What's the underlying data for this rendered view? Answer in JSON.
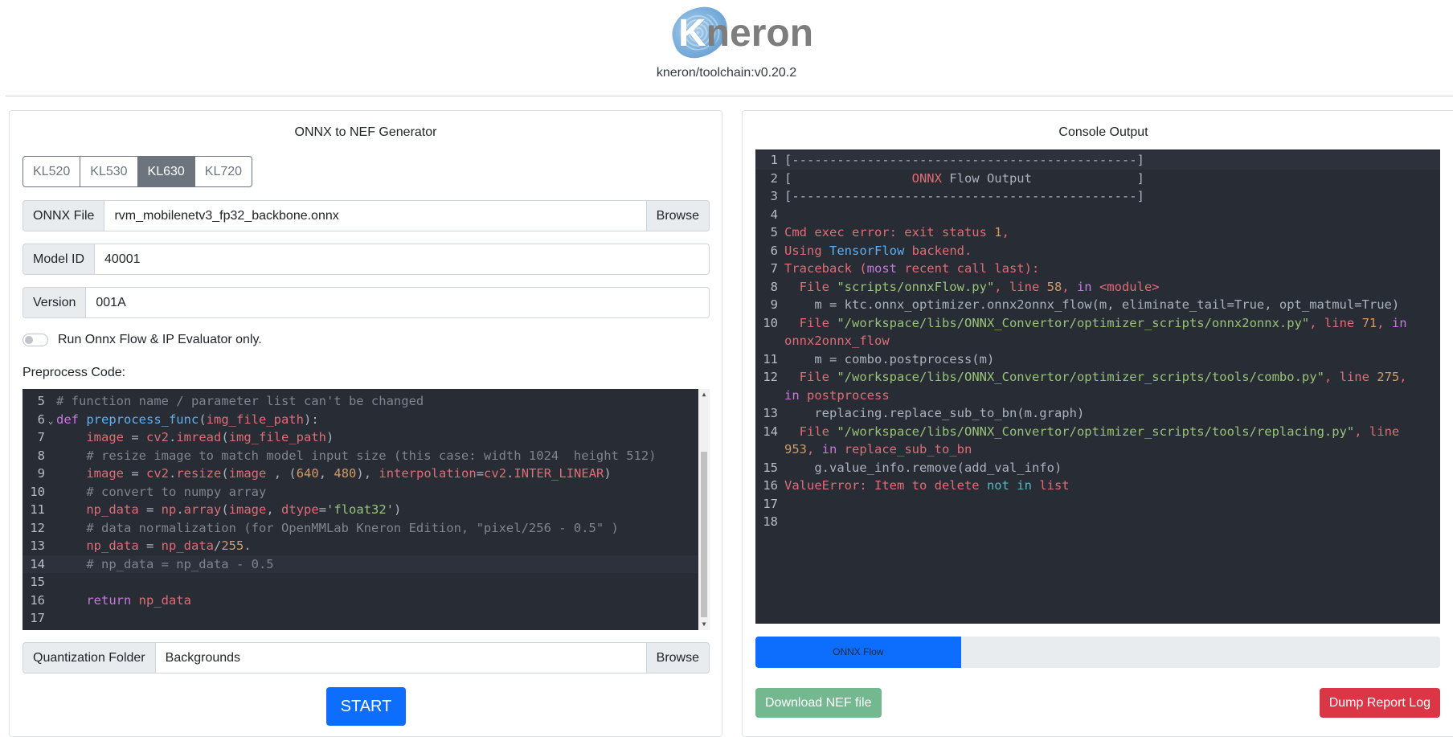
{
  "header": {
    "logo_text": "Kneron",
    "version": "kneron/toolchain:v0.20.2"
  },
  "left": {
    "title": "ONNX to NEF Generator",
    "platforms": [
      {
        "label": "KL520",
        "active": false
      },
      {
        "label": "KL530",
        "active": false
      },
      {
        "label": "KL630",
        "active": true
      },
      {
        "label": "KL720",
        "active": false
      }
    ],
    "onnx_file": {
      "label": "ONNX File",
      "value": "rvm_mobilenetv3_fp32_backbone.onnx",
      "browse": "Browse"
    },
    "model_id": {
      "label": "Model ID",
      "value": "40001"
    },
    "version": {
      "label": "Version",
      "value": "001A"
    },
    "toggle": {
      "label": "Run Onnx Flow & IP Evaluator only.",
      "on": false
    },
    "preprocess_label": "Preprocess Code:",
    "code_lines": [
      {
        "n": "5",
        "text": "# function name / parameter list can't be changed"
      },
      {
        "n": "6",
        "text": "def preprocess_func(img_file_path):"
      },
      {
        "n": "7",
        "text": "    image = cv2.imread(img_file_path)"
      },
      {
        "n": "8",
        "text": "    # resize image to match model input size (this case: width 1024  height 512)"
      },
      {
        "n": "9",
        "text": "    image = cv2.resize(image , (640, 480), interpolation=cv2.INTER_LINEAR)"
      },
      {
        "n": "10",
        "text": "    # convert to numpy array"
      },
      {
        "n": "11",
        "text": "    np_data = np.array(image, dtype='float32')"
      },
      {
        "n": "12",
        "text": "    # data normalization (for OpenMMLab Kneron Edition, \"pixel/256 - 0.5\" )"
      },
      {
        "n": "13",
        "text": "    np_data = np_data/255."
      },
      {
        "n": "14",
        "text": "    # np_data = np_data - 0.5"
      },
      {
        "n": "15",
        "text": ""
      },
      {
        "n": "16",
        "text": "    return np_data"
      },
      {
        "n": "17",
        "text": ""
      }
    ],
    "quant_folder": {
      "label": "Quantization Folder",
      "value": "Backgrounds",
      "browse": "Browse"
    },
    "start_label": "START"
  },
  "right": {
    "title": "Console Output",
    "console_lines": [
      {
        "n": "1",
        "text": "[----------------------------------------------]"
      },
      {
        "n": "2",
        "text": "[                ONNX Flow Output              ]"
      },
      {
        "n": "3",
        "text": "[----------------------------------------------]"
      },
      {
        "n": "4",
        "text": ""
      },
      {
        "n": "5",
        "text": "Cmd exec error: exit status 1,"
      },
      {
        "n": "6",
        "text": "Using TensorFlow backend."
      },
      {
        "n": "7",
        "text": "Traceback (most recent call last):"
      },
      {
        "n": "8",
        "text": "  File \"scripts/onnxFlow.py\", line 58, in <module>"
      },
      {
        "n": "9",
        "text": "    m = ktc.onnx_optimizer.onnx2onnx_flow(m, eliminate_tail=True, opt_matmul=True)"
      },
      {
        "n": "10",
        "text": "  File \"/workspace/libs/ONNX_Convertor/optimizer_scripts/onnx2onnx.py\", line 71, in onnx2onnx_flow"
      },
      {
        "n": "11",
        "text": "    m = combo.postprocess(m)"
      },
      {
        "n": "12",
        "text": "  File \"/workspace/libs/ONNX_Convertor/optimizer_scripts/tools/combo.py\", line 275, in postprocess"
      },
      {
        "n": "13",
        "text": "    replacing.replace_sub_to_bn(m.graph)"
      },
      {
        "n": "14",
        "text": "  File \"/workspace/libs/ONNX_Convertor/optimizer_scripts/tools/replacing.py\", line 953, in replace_sub_to_bn"
      },
      {
        "n": "15",
        "text": "    g.value_info.remove(add_val_info)"
      },
      {
        "n": "16",
        "text": "ValueError: Item to delete not in list"
      },
      {
        "n": "17",
        "text": ""
      },
      {
        "n": "18",
        "text": ""
      }
    ],
    "progress": {
      "label": "ONNX Flow",
      "percent": 30
    },
    "download_label": "Download NEF file",
    "dump_label": "Dump Report Log"
  },
  "colors": {
    "primary": "#0d6efd",
    "success_disabled": "#6db58a",
    "danger": "#dc3545",
    "editor_bg": "#282c34"
  }
}
